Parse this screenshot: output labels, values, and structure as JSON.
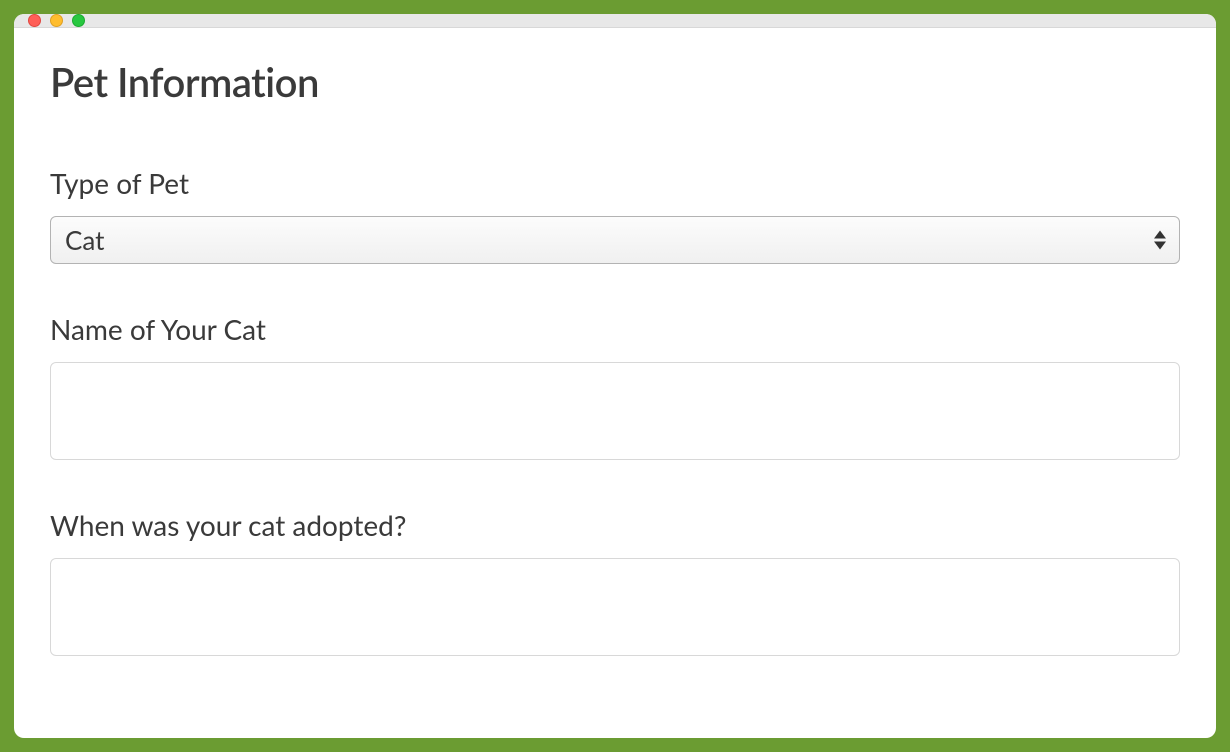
{
  "form": {
    "title": "Pet Information",
    "fields": {
      "type": {
        "label": "Type of Pet",
        "value": "Cat"
      },
      "name": {
        "label": "Name of Your Cat",
        "value": ""
      },
      "adopted": {
        "label": "When was your cat adopted?",
        "value": ""
      }
    }
  }
}
